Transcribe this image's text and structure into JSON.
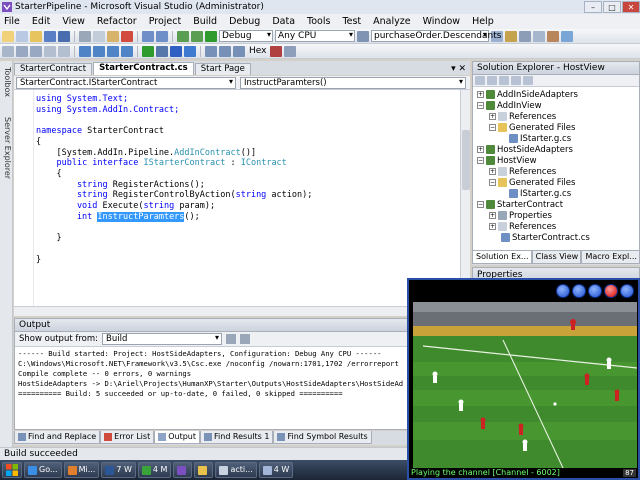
{
  "window": {
    "title": "StarterPipeline - Microsoft Visual Studio (Administrator)",
    "controls": [
      "–",
      "□",
      "✕"
    ]
  },
  "menu": [
    "File",
    "Edit",
    "View",
    "Refactor",
    "Project",
    "Build",
    "Debug",
    "Data",
    "Tools",
    "Test",
    "Analyze",
    "Window",
    "Help"
  ],
  "toolbar": {
    "config": "Debug",
    "platform": "Any CPU",
    "find_combo": "purchaseOrder.Descendants",
    "hex_label": "Hex"
  },
  "side_tabs": [
    "Toolbox",
    "Server Explorer"
  ],
  "doc_tabs": [
    "StarterContract",
    "StarterContract.cs",
    "Start Page"
  ],
  "doc_tab_close": "▾ ✕",
  "nav": {
    "left": "StarterContract.IStarterContract",
    "right": "InstructParamters()"
  },
  "code": {
    "l1": "using System.Text;",
    "l2": "using System.AddIn.Contract;",
    "l3": "",
    "l4_kw": "namespace",
    "l4": " StarterContract",
    "l5": "{",
    "l6_a": "    [System.AddIn.Pipeline.",
    "l6_b": "AddInContract",
    "l6_c": "()]",
    "l7_a": "    ",
    "l7_kw": "public interface",
    "l7_ty": " IStarterContract",
    "l7_b": " : ",
    "l7_ty2": "IContract",
    "l8": "    {",
    "l9_kw": "        string",
    "l9": " RegisterActions();",
    "l10_kw": "        string",
    "l10_a": " RegisterControlByAction(",
    "l10_kw2": "string",
    "l10_b": " action);",
    "l11_kw": "        void",
    "l11_a": " Execute(",
    "l11_kw2": "string",
    "l11_b": " param);",
    "l12_kw": "        int",
    "l12_hl": "InstructParamters",
    "l12_b": "();",
    "l13": "",
    "l14": "    }",
    "l15": "",
    "l16": "}"
  },
  "output": {
    "title": "Output",
    "show_from_label": "Show output from:",
    "source": "Build",
    "lines": [
      "------ Build started: Project: HostSideAdapters, Configuration: Debug Any CPU ------",
      "C:\\Windows\\Microsoft.NET\\Framework\\v3.5\\Csc.exe /noconfig /nowarn:1701,1702 /errorreport",
      "",
      "Compile complete -- 0 errors, 0 warnings",
      "HostSideAdapters -> D:\\Ariel\\Projects\\HumanXP\\Starter\\Outputs\\HostSideAdapters\\HostSideAd",
      "========== Build: 5 succeeded or up-to-date, 0 failed, 0 skipped =========="
    ]
  },
  "bottom_tabs": [
    "Find and Replace",
    "Error List",
    "Output",
    "Find Results 1",
    "Find Symbol Results"
  ],
  "status": "Build succeeded",
  "taskbar": [
    "Go...",
    "Mi...",
    "7 W",
    "4 M",
    "",
    "",
    "acti...",
    "4 W"
  ],
  "solution_explorer": {
    "title": "Solution Explorer - HostView",
    "items": [
      "AddInSideAdapters",
      "AddInView",
      "References",
      "Generated Files",
      "IStarter.g.cs",
      "HostSideAdapters",
      "HostView",
      "References",
      "Generated Files",
      "IStarter.g.cs",
      "StarterContract",
      "Properties",
      "References",
      "StarterContract.cs"
    ],
    "tabs": [
      "Solution Ex...",
      "Class View",
      "Macro Expl..."
    ]
  },
  "properties_title": "Properties",
  "player": {
    "status": "Playing the channel [Channel - 6002]",
    "badge": "87"
  },
  "colors": {
    "keyword": "#0000ff",
    "type": "#2b91af",
    "selection": "#3399ff",
    "player_border": "#2a4fa6",
    "pitch": "#3f8a2c"
  }
}
